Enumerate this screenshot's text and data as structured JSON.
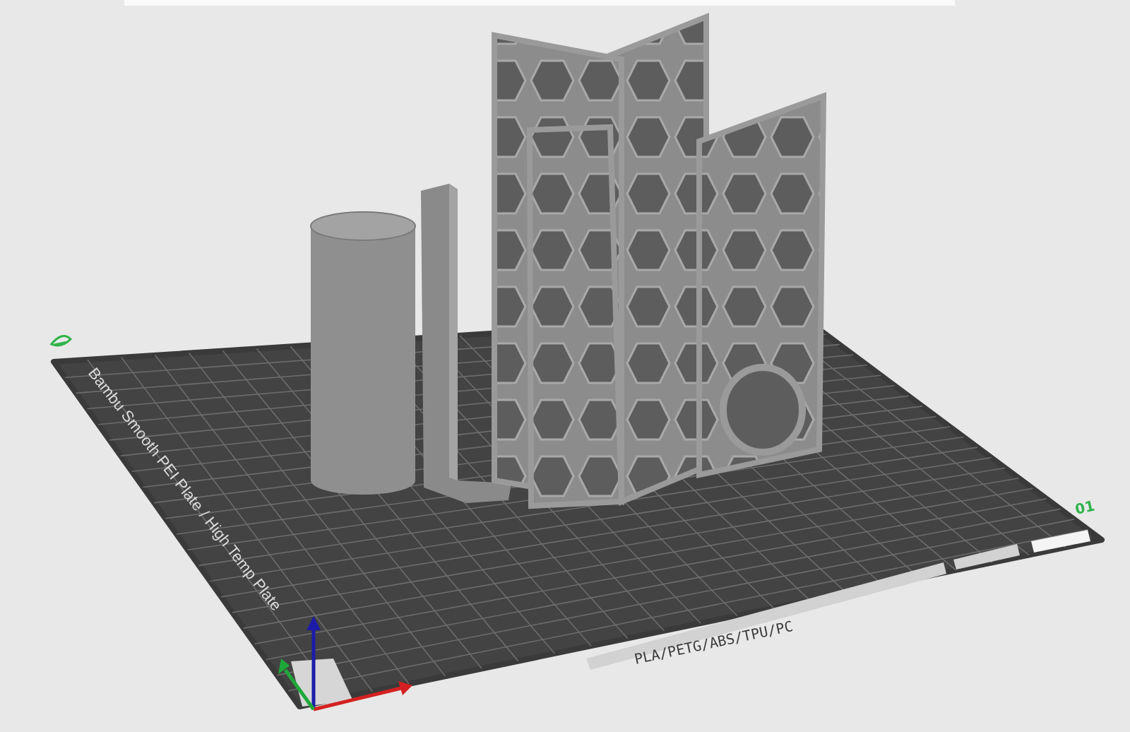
{
  "plate": {
    "label": "Bambu Smooth PEI Plate / High Temp Plate",
    "filaments": "PLA/PETG/ABS/TPU/PC",
    "number": "01"
  }
}
